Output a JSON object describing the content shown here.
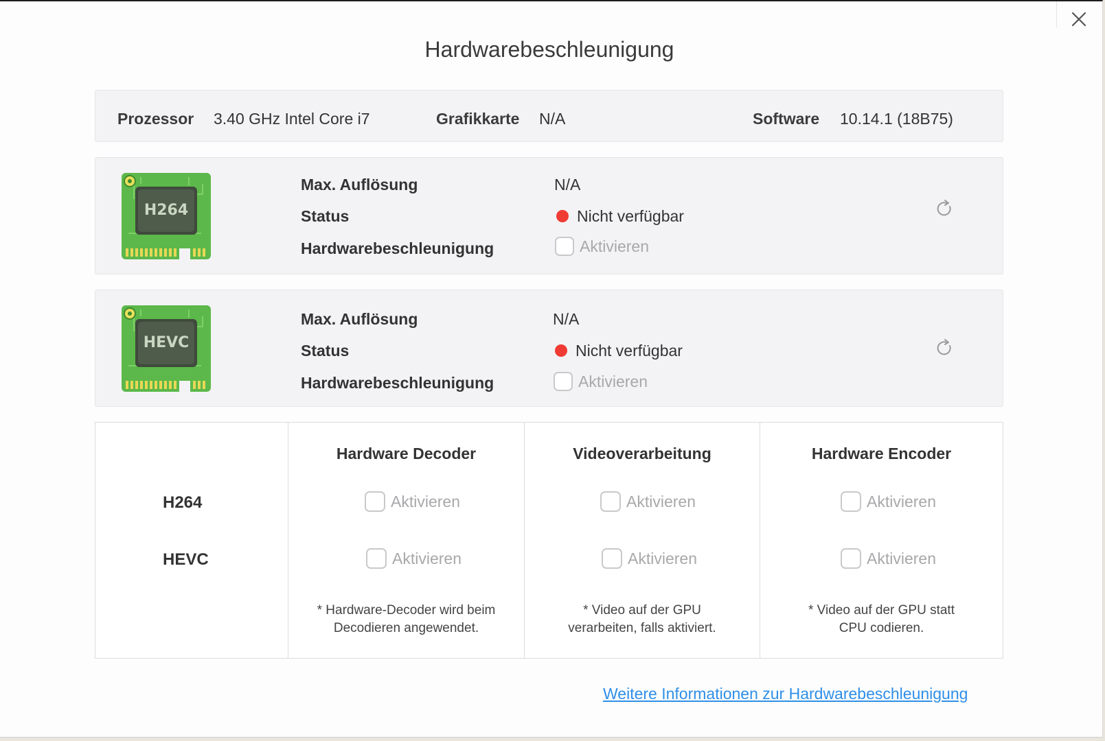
{
  "dialog": {
    "title": "Hardwarebeschleunigung"
  },
  "info": {
    "processor_label": "Prozessor",
    "processor_value": "3.40 GHz Intel Core i7",
    "gpu_label": "Grafikkarte",
    "gpu_value": "N/A",
    "software_label": "Software",
    "software_value": "10.14.1 (18B75)"
  },
  "codecs": [
    {
      "chip_text": "H264",
      "resolution_label": "Max. Auflösung",
      "resolution_value": "N/A",
      "status_label": "Status",
      "status_value": "Nicht verfügbar",
      "status_color": "#ef3b34",
      "accel_label": "Hardwarebeschleunigung",
      "accel_checkbox_label": "Aktivieren"
    },
    {
      "chip_text": "HEVC",
      "resolution_label": "Max. Auflösung",
      "resolution_value": "N/A",
      "status_label": "Status",
      "status_value": "Nicht verfügbar",
      "status_color": "#ef3b34",
      "accel_label": "Hardwarebeschleunigung",
      "accel_checkbox_label": "Aktivieren"
    }
  ],
  "matrix": {
    "columns": [
      "Hardware Decoder",
      "Videoverarbeitung",
      "Hardware Encoder"
    ],
    "rows": [
      "H264",
      "HEVC"
    ],
    "checkbox_label": "Aktivieren",
    "notes": [
      [
        "* Hardware-Decoder wird beim",
        "Decodieren angewendet."
      ],
      [
        "* Video auf der GPU",
        "verarbeiten, falls aktiviert."
      ],
      [
        "* Video auf der GPU statt",
        "CPU codieren."
      ]
    ]
  },
  "footer": {
    "link_text": "Weitere Informationen zur Hardwarebeschleunigung"
  },
  "icons": {
    "close": "close-icon",
    "refresh": "refresh-icon",
    "chip": "chip-icon"
  },
  "colors": {
    "link": "#2f8fe8",
    "status_unavailable": "#ef3b34",
    "chip_green": "#5cb84a"
  }
}
